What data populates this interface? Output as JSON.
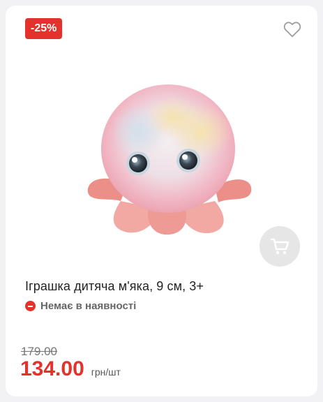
{
  "product": {
    "discount_badge": "-25%",
    "title": "Іграшка дитяча м'яка, 9 см, 3+",
    "stock_status": "Немає в наявності",
    "old_price": "179.00",
    "price": "134.00",
    "unit": "грн/шт"
  },
  "icons": {
    "favorite": "heart-outline-icon",
    "cart": "cart-icon",
    "stock": "minus-circle-icon"
  },
  "colors": {
    "accent": "#e4312b",
    "cart_button_bg": "#e6e6e6"
  }
}
